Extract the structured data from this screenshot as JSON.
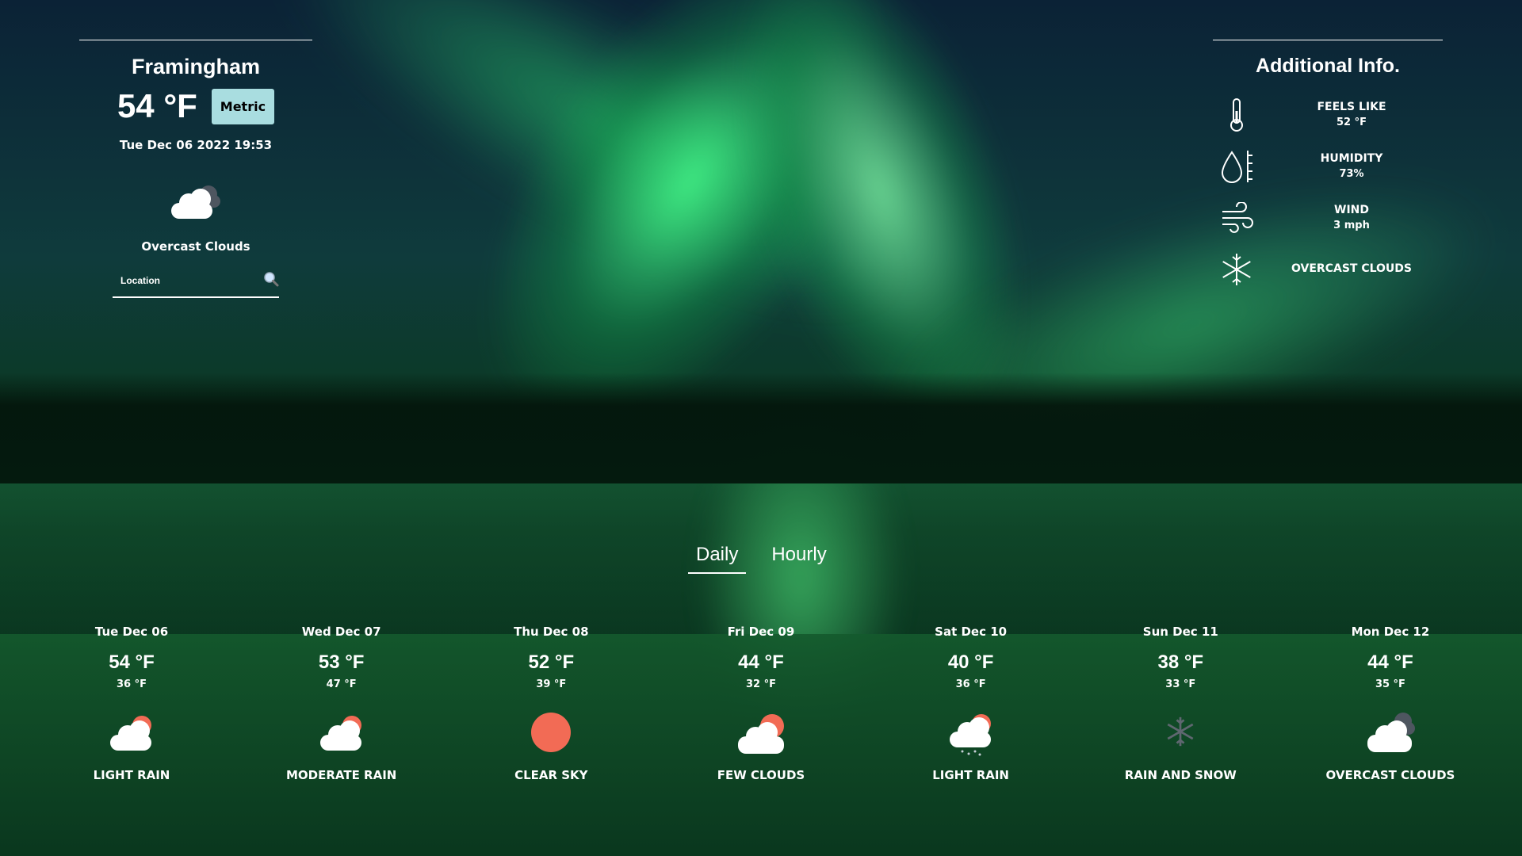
{
  "current": {
    "city": "Framingham",
    "temp": "54 °F",
    "unit_toggle": "Metric",
    "datetime": "Tue Dec 06 2022 19:53",
    "condition": "Overcast Clouds",
    "icon": "overcast-cloud-icon"
  },
  "search": {
    "placeholder": "Location"
  },
  "additional": {
    "title": "Additional Info.",
    "items": [
      {
        "label": "FEELS LIKE",
        "value": "52 °F",
        "icon": "thermometer-icon"
      },
      {
        "label": "HUMIDITY",
        "value": "73%",
        "icon": "humidity-drop-icon"
      },
      {
        "label": "WIND",
        "value": "3 mph",
        "icon": "wind-icon"
      },
      {
        "label": "OVERCAST CLOUDS",
        "value": "",
        "icon": "snowflake-icon"
      }
    ]
  },
  "tabs": {
    "daily": "Daily",
    "hourly": "Hourly",
    "active": "daily"
  },
  "forecast": [
    {
      "day": "Tue Dec 06",
      "hi": "54 °F",
      "lo": "36 °F",
      "desc": "LIGHT RAIN",
      "icon": "sun-cloud-icon"
    },
    {
      "day": "Wed Dec 07",
      "hi": "53 °F",
      "lo": "47 °F",
      "desc": "MODERATE RAIN",
      "icon": "sun-cloud-icon"
    },
    {
      "day": "Thu Dec 08",
      "hi": "52 °F",
      "lo": "39 °F",
      "desc": "CLEAR SKY",
      "icon": "sun-icon"
    },
    {
      "day": "Fri Dec 09",
      "hi": "44 °F",
      "lo": "32 °F",
      "desc": "FEW CLOUDS",
      "icon": "sun-cloud-icon"
    },
    {
      "day": "Sat Dec 10",
      "hi": "40 °F",
      "lo": "36 °F",
      "desc": "LIGHT RAIN",
      "icon": "rain-cloud-icon"
    },
    {
      "day": "Sun Dec 11",
      "hi": "38 °F",
      "lo": "33 °F",
      "desc": "RAIN AND SNOW",
      "icon": "snowflake-icon"
    },
    {
      "day": "Mon Dec 12",
      "hi": "44 °F",
      "lo": "35 °F",
      "desc": "OVERCAST CLOUDS",
      "icon": "overcast-cloud-icon"
    }
  ],
  "colors": {
    "accent_button": "#a9dde0",
    "sun": "#f26b55",
    "text": "#ffffff"
  }
}
